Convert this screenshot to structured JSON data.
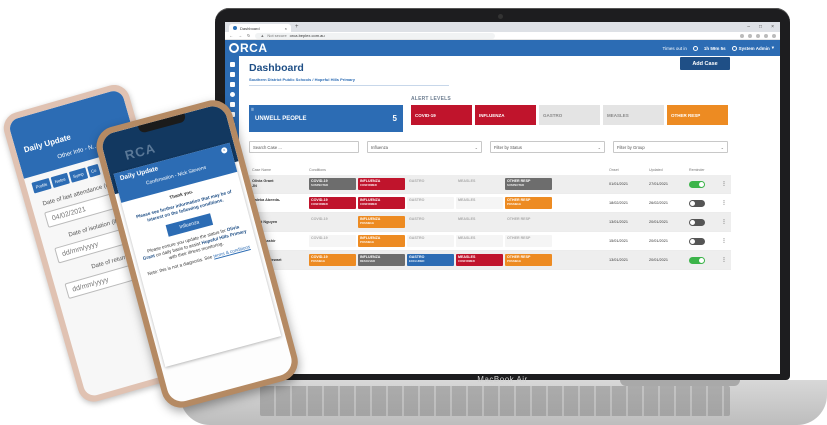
{
  "browser": {
    "tab_title": "Dashboard",
    "new_tab": "+",
    "tab_close": "×",
    "not_secure": "Not secure",
    "url": "orca.beplex.com.au",
    "win_min": "–",
    "win_max": "□",
    "win_close": "×"
  },
  "appbar": {
    "brand": "RCA",
    "times_out_label": "Times out in",
    "times_out_value": "1h 59m 5s",
    "user": "System Admin"
  },
  "page": {
    "title": "Dashboard",
    "breadcrumb": "Southern District Public Schools / Hopeful Hills Primary",
    "add_case": "Add Case"
  },
  "unwell": {
    "label": "UNWELL PEOPLE",
    "count": "5"
  },
  "alerts": {
    "title": "ALERT LEVELS",
    "items": [
      {
        "label": "COVID-19",
        "bg": "#c0142c",
        "fg": "#ffffff"
      },
      {
        "label": "INFLUENZA",
        "bg": "#c0142c",
        "fg": "#ffffff"
      },
      {
        "label": "GASTRO",
        "bg": "#e4e4e4",
        "fg": "#8a8a8a"
      },
      {
        "label": "MEASLES",
        "bg": "#e4e4e4",
        "fg": "#8a8a8a"
      },
      {
        "label": "OTHER RESP",
        "bg": "#ed8b22",
        "fg": "#ffffff"
      }
    ]
  },
  "filters": {
    "search_placeholder": "Search Case ...",
    "condition": "Influenza",
    "status": "Filter by Status",
    "group": "Filter by Group"
  },
  "table": {
    "headers": [
      "Case Name",
      "Conditions",
      "Onset",
      "Updated",
      "Reminder"
    ],
    "rows": [
      {
        "name": "Olivia Grant",
        "name2": "JN",
        "conds": [
          {
            "label": "COVID-19",
            "sub": "SUSPECTED",
            "bg": "#6d6d6d",
            "fg": "#ffffff"
          },
          {
            "label": "INFLUENZA",
            "sub": "CONFIRMED",
            "bg": "#c0142c",
            "fg": "#ffffff"
          },
          {
            "label": "GASTRO",
            "sub": "",
            "bg": "#eeeeee",
            "fg": "#aaaaaa"
          },
          {
            "label": "MEASLES",
            "sub": "",
            "bg": "#eeeeee",
            "fg": "#aaaaaa"
          },
          {
            "label": "OTHER RESP",
            "sub": "SUSPECTED",
            "bg": "#6d6d6d",
            "fg": "#ffffff"
          }
        ],
        "onset": "01/01/2021",
        "updated": "27/01/2021",
        "reminder": true
      },
      {
        "name": "Haleka Abeeda-",
        "name2": "ali",
        "conds": [
          {
            "label": "COVID-19",
            "sub": "CONFIRMED",
            "bg": "#c0142c",
            "fg": "#ffffff"
          },
          {
            "label": "INFLUENZA",
            "sub": "CONFIRMED",
            "bg": "#c0142c",
            "fg": "#ffffff"
          },
          {
            "label": "GASTRO",
            "sub": "",
            "bg": "#f5f5f5",
            "fg": "#aaaaaa"
          },
          {
            "label": "MEASLES",
            "sub": "",
            "bg": "#f5f5f5",
            "fg": "#aaaaaa"
          },
          {
            "label": "OTHER RESP",
            "sub": "POSSIBLE",
            "bg": "#ed8b22",
            "fg": "#ffffff"
          }
        ],
        "onset": "18/02/2021",
        "updated": "26/02/2021",
        "reminder": false
      },
      {
        "name": "Violet Nguyen",
        "name2": "",
        "conds": [
          {
            "label": "COVID-19",
            "sub": "",
            "bg": "#eeeeee",
            "fg": "#aaaaaa"
          },
          {
            "label": "INFLUENZA",
            "sub": "POSSIBLE",
            "bg": "#ed8b22",
            "fg": "#ffffff"
          },
          {
            "label": "GASTRO",
            "sub": "",
            "bg": "#eeeeee",
            "fg": "#aaaaaa"
          },
          {
            "label": "MEASLES",
            "sub": "",
            "bg": "#eeeeee",
            "fg": "#aaaaaa"
          },
          {
            "label": "OTHER RESP",
            "sub": "",
            "bg": "#eeeeee",
            "fg": "#aaaaaa"
          }
        ],
        "onset": "13/01/2021",
        "updated": "20/01/2021",
        "reminder": false
      },
      {
        "name": "Abdul Bashir",
        "name2": "",
        "conds": [
          {
            "label": "COVID-19",
            "sub": "",
            "bg": "#f5f5f5",
            "fg": "#aaaaaa"
          },
          {
            "label": "INFLUENZA",
            "sub": "POSSIBLE",
            "bg": "#ed8b22",
            "fg": "#ffffff"
          },
          {
            "label": "GASTRO",
            "sub": "",
            "bg": "#f5f5f5",
            "fg": "#aaaaaa"
          },
          {
            "label": "MEASLES",
            "sub": "",
            "bg": "#f5f5f5",
            "fg": "#aaaaaa"
          },
          {
            "label": "OTHER RESP",
            "sub": "",
            "bg": "#f5f5f5",
            "fg": "#aaaaaa"
          }
        ],
        "onset": "15/01/2021",
        "updated": "20/01/2021",
        "reminder": false
      },
      {
        "name": "Charlize Stewart",
        "name2": "",
        "conds": [
          {
            "label": "COVID-19",
            "sub": "POSSIBLE",
            "bg": "#ed8b22",
            "fg": "#ffffff"
          },
          {
            "label": "INFLUENZA",
            "sub": "RESOLVED",
            "bg": "#6d6d6d",
            "fg": "#ffffff"
          },
          {
            "label": "GASTRO",
            "sub": "EXCLUDED",
            "bg": "#2c6cb4",
            "fg": "#ffffff"
          },
          {
            "label": "MEASLES",
            "sub": "CONFIRMED",
            "bg": "#c0142c",
            "fg": "#ffffff"
          },
          {
            "label": "OTHER RESP",
            "sub": "POSSIBLE",
            "bg": "#ed8b22",
            "fg": "#ffffff"
          }
        ],
        "onset": "13/01/2021",
        "updated": "20/01/2021",
        "reminder": true
      }
    ]
  },
  "laptop": {
    "model": "MacBook Air"
  },
  "phone_back": {
    "title": "Daily Update",
    "subtitle": "Other Info - N...",
    "tabs": [
      "Profile",
      "Notes",
      "Symp",
      "Co"
    ],
    "field1_label": "Date of last attendance (mandatory)",
    "field1_value": "04/02/2021",
    "field2_label": "Date of isolation (if ap...",
    "field2_value": "dd/mm/yyyy",
    "field3_label": "Date of return",
    "field3_value": "dd/mm/yyyy"
  },
  "phone_front": {
    "brand": "RCA",
    "title": "Daily Update",
    "subtitle": "Confirmation - Nick Stevens",
    "close": "×",
    "thanks": "Thank you.",
    "info": "Please see further information that may be of interest on the following conditions.",
    "button": "Influenza",
    "note_pre": "Please ensure you update the status for",
    "note_name": "Olivia Grant",
    "note_mid": "on daily basis to assist",
    "note_school": "Hopeful Hills Primary",
    "note_post": "with their illness monitoring.",
    "diag": "Note: this is not a diagnosis. See",
    "terms": "terms & conditions"
  },
  "colors": {
    "primary": "#2c6cb4",
    "dark": "#1f4f86",
    "red": "#c0142c",
    "orange": "#ed8b22",
    "green": "#3cb44a"
  }
}
